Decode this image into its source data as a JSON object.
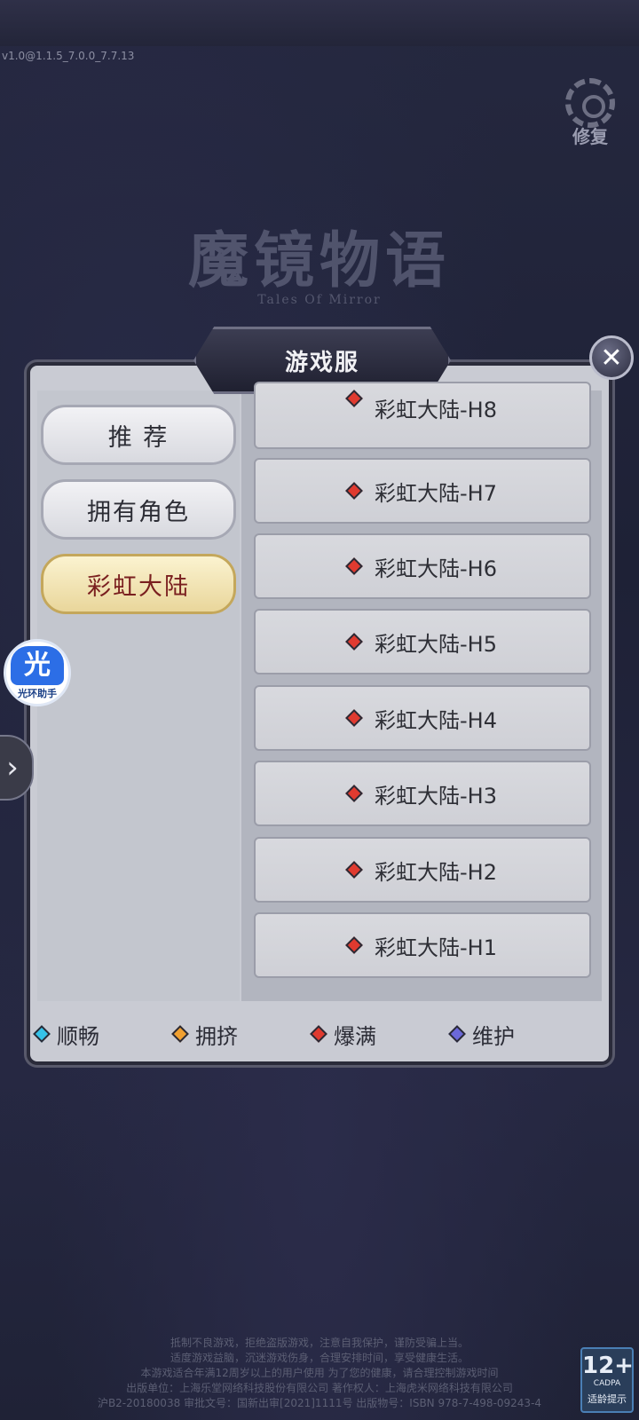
{
  "version": "v1.0@1.1.5_7.0.0_7.7.13",
  "repair_label": "修复",
  "logo": {
    "title": "魔镜物语",
    "subtitle": "Tales Of Mirror"
  },
  "dialog": {
    "title": "游戏服",
    "tabs": [
      {
        "label": "推 荐",
        "active": false
      },
      {
        "label": "拥有角色",
        "active": false
      },
      {
        "label": "彩虹大陆",
        "active": true
      }
    ],
    "servers": [
      {
        "name": "彩虹大陆-H8",
        "status": "爆满"
      },
      {
        "name": "彩虹大陆-H7",
        "status": "爆满"
      },
      {
        "name": "彩虹大陆-H6",
        "status": "爆满"
      },
      {
        "name": "彩虹大陆-H5",
        "status": "爆满"
      },
      {
        "name": "彩虹大陆-H4",
        "status": "爆满"
      },
      {
        "name": "彩虹大陆-H3",
        "status": "爆满"
      },
      {
        "name": "彩虹大陆-H2",
        "status": "爆满"
      },
      {
        "name": "彩虹大陆-H1",
        "status": "爆满"
      }
    ],
    "legend": [
      {
        "label": "顺畅",
        "color": "#35c2e8"
      },
      {
        "label": "拥挤",
        "color": "#f0a030"
      },
      {
        "label": "爆满",
        "color": "#e03a2f"
      },
      {
        "label": "维护",
        "color": "#6b68d8"
      }
    ]
  },
  "helper": {
    "big": "光",
    "small": "光环助手"
  },
  "footer": {
    "lines": [
      "抵制不良游戏，拒绝盗版游戏，注意自我保护，谨防受骗上当。",
      "适度游戏益脑，沉迷游戏伤身，合理安排时间，享受健康生活。",
      "本游戏适合年满12周岁以上的用户使用 为了您的健康，请合理控制游戏时间",
      "出版单位：上海乐堂网络科技股份有限公司 著作权人：上海虎米网络科技有限公司",
      "沪B2-20180038 审批文号：国新出审[2021]1111号 出版物号：ISBN 978-7-498-09243-4"
    ]
  },
  "age_rating": {
    "number": "12+",
    "org": "CADPA",
    "text": "适龄提示"
  },
  "colors": {
    "full_status": "#e03a2f",
    "active_tab_text": "#7a1f1f"
  }
}
